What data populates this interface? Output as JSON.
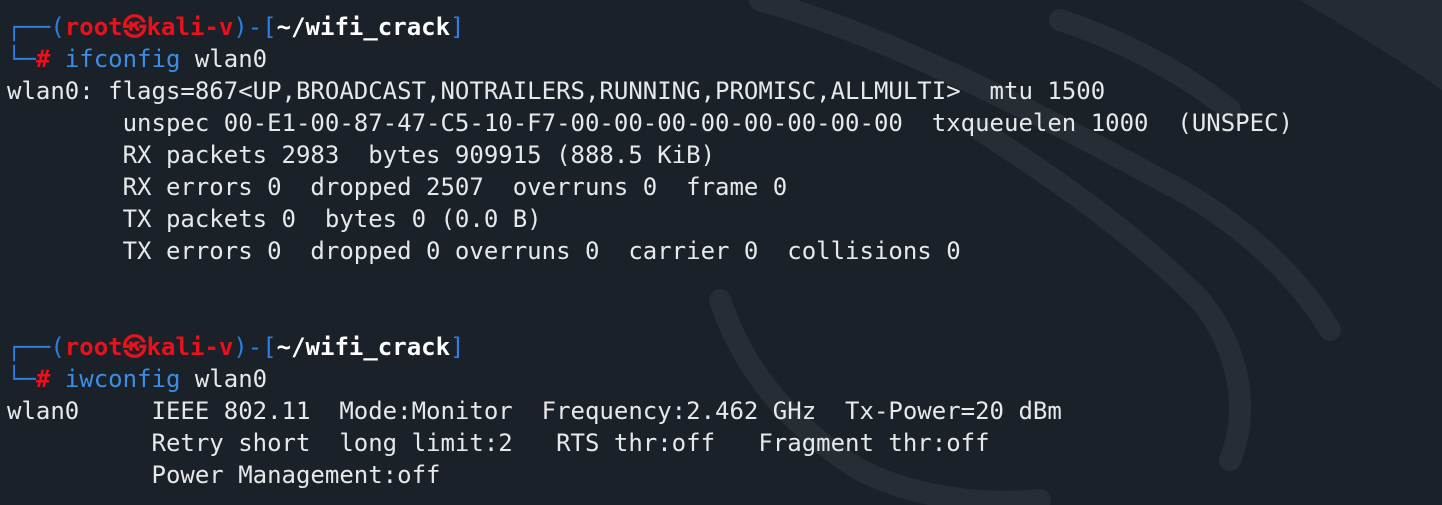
{
  "colors": {
    "background": "#1b2128",
    "prompt_frame": "#2a7fe4",
    "prompt_user": "#e8121e",
    "command": "#3a8ee8",
    "text": "#e6e8ea"
  },
  "prompts": [
    {
      "frame_top_left": "┌──(",
      "user": "root",
      "separator_icon": "㉿",
      "host": "kali-v",
      "frame_mid": ")-[",
      "cwd": "~/wifi_crack",
      "frame_close": "]",
      "frame_bottom": "└─",
      "symbol": "#",
      "command": "ifconfig",
      "argument": "wlan0"
    },
    {
      "frame_top_left": "┌──(",
      "user": "root",
      "separator_icon": "㉿",
      "host": "kali-v",
      "frame_mid": ")-[",
      "cwd": "~/wifi_crack",
      "frame_close": "]",
      "frame_bottom": "└─",
      "symbol": "#",
      "command": "iwconfig",
      "argument": "wlan0"
    }
  ],
  "ifconfig_output": [
    "wlan0: flags=867<UP,BROADCAST,NOTRAILERS,RUNNING,PROMISC,ALLMULTI>  mtu 1500",
    "        unspec 00-E1-00-87-47-C5-10-F7-00-00-00-00-00-00-00-00  txqueuelen 1000  (UNSPEC)",
    "        RX packets 2983  bytes 909915 (888.5 KiB)",
    "        RX errors 0  dropped 2507  overruns 0  frame 0",
    "        TX packets 0  bytes 0 (0.0 B)",
    "        TX errors 0  dropped 0 overruns 0  carrier 0  collisions 0"
  ],
  "iwconfig_output": [
    "wlan0     IEEE 802.11  Mode:Monitor  Frequency:2.462 GHz  Tx-Power=20 dBm",
    "          Retry short  long limit:2   RTS thr:off   Fragment thr:off",
    "          Power Management:off"
  ]
}
